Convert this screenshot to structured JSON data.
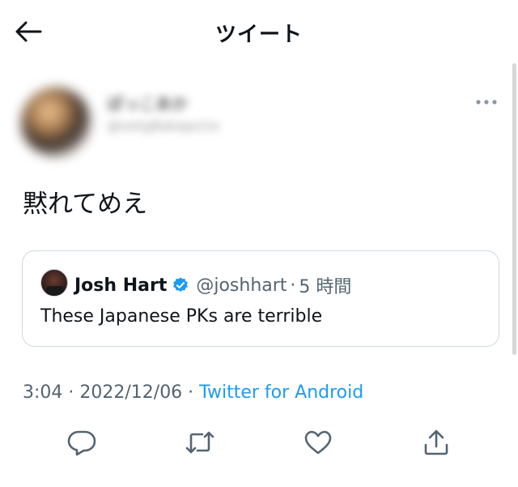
{
  "header": {
    "back_icon": "arrow-left-icon",
    "title": "ツイート"
  },
  "author": {
    "name": "ぽっこあか",
    "handle": "@ootg8akapo1e"
  },
  "tweet": {
    "text": "黙れてめえ",
    "timestamp": "3:04 · 2022/12/06 ·",
    "source": "Twitter for Android"
  },
  "quote": {
    "name": "Josh Hart",
    "handle": "@joshhart",
    "separator": "·",
    "time": "5 時間",
    "text": "These Japanese PKs are terrible",
    "verified_color": "#1d9bf0"
  },
  "actions": [
    {
      "icon": "reply-icon"
    },
    {
      "icon": "retweet-icon"
    },
    {
      "icon": "like-icon"
    },
    {
      "icon": "share-icon"
    }
  ],
  "colors": {
    "accent": "#1d9bf0",
    "text": "#0f1419",
    "secondary": "#536471",
    "border": "#cfd9de"
  }
}
